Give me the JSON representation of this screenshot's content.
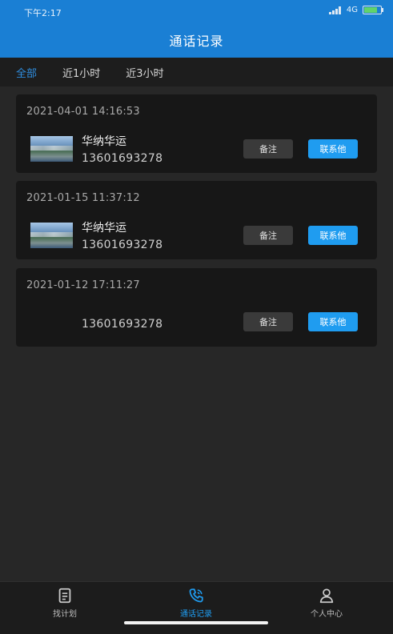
{
  "status_bar": {
    "time": "下午2:17",
    "network": "4G"
  },
  "header": {
    "title": "通话记录"
  },
  "filters": [
    {
      "label": "全部",
      "active": true
    },
    {
      "label": "近1小时",
      "active": false
    },
    {
      "label": "近3小时",
      "active": false
    }
  ],
  "records": [
    {
      "time": "2021-04-01 14:16:53",
      "company": "华纳华运",
      "phone": "13601693278",
      "note_label": "备注",
      "contact_label": "联系他"
    },
    {
      "time": "2021-01-15 11:37:12",
      "company": "华纳华运",
      "phone": "13601693278",
      "note_label": "备注",
      "contact_label": "联系他"
    },
    {
      "time": "2021-01-12 17:11:27",
      "company": "",
      "phone": "13601693278",
      "note_label": "备注",
      "contact_label": "联系他"
    }
  ],
  "bottom_nav": [
    {
      "label": "找计划",
      "icon": "clipboard-icon",
      "active": false
    },
    {
      "label": "通话记录",
      "icon": "phone-call-icon",
      "active": true
    },
    {
      "label": "个人中心",
      "icon": "person-icon",
      "active": false
    }
  ],
  "colors": {
    "accent": "#1f9cf0",
    "header": "#1a7fd4",
    "background": "#272727",
    "card": "#171717"
  }
}
